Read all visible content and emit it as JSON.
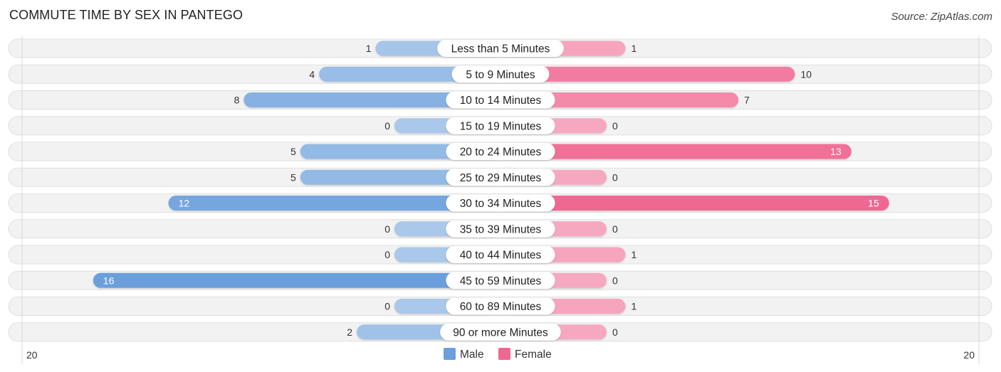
{
  "header": {
    "title": "COMMUTE TIME BY SEX IN PANTEGO",
    "source": "Source: ZipAtlas.com"
  },
  "colors": {
    "male_strong": "#6a9fdc",
    "male_light": "#a9c8ea",
    "female_strong": "#f06892",
    "female_light": "#f7a8c1",
    "track": "#f2f2f2"
  },
  "chart_data": {
    "type": "bar",
    "orientation": "horizontal-diverging",
    "title": "COMMUTE TIME BY SEX IN PANTEGO",
    "categories": [
      "Less than 5 Minutes",
      "5 to 9 Minutes",
      "10 to 14 Minutes",
      "15 to 19 Minutes",
      "20 to 24 Minutes",
      "25 to 29 Minutes",
      "30 to 34 Minutes",
      "35 to 39 Minutes",
      "40 to 44 Minutes",
      "45 to 59 Minutes",
      "60 to 89 Minutes",
      "90 or more Minutes"
    ],
    "series": [
      {
        "name": "Male",
        "values": [
          1,
          4,
          8,
          0,
          5,
          5,
          12,
          0,
          0,
          16,
          0,
          2
        ]
      },
      {
        "name": "Female",
        "values": [
          1,
          10,
          7,
          0,
          13,
          0,
          15,
          0,
          1,
          0,
          1,
          0
        ]
      }
    ],
    "axis": {
      "left_max_label": "20",
      "right_max_label": "20",
      "range": [
        0,
        20
      ]
    },
    "legend": {
      "position": "bottom-center",
      "entries": [
        "Male",
        "Female"
      ]
    },
    "grid": false
  }
}
